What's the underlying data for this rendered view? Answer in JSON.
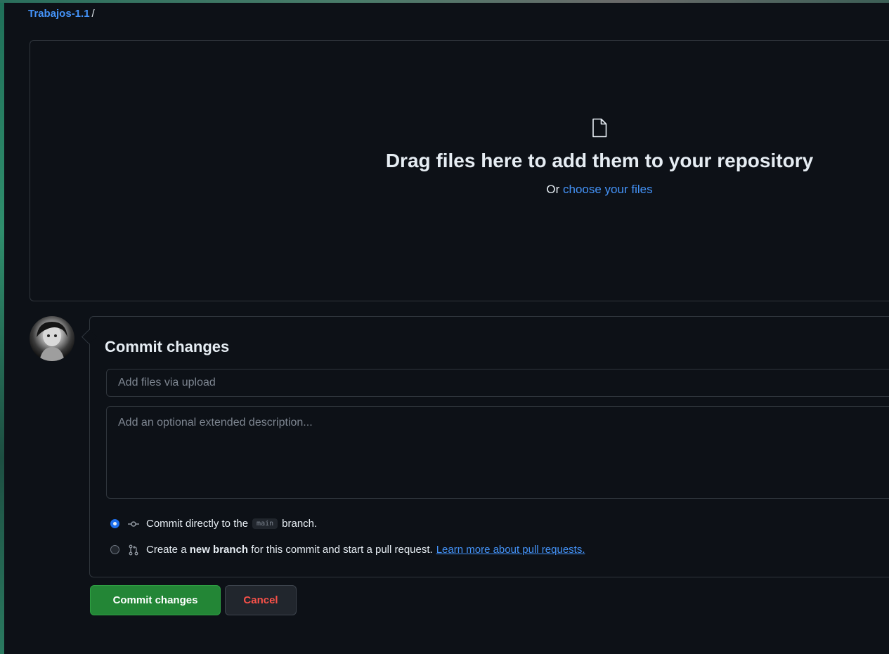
{
  "breadcrumb": {
    "repo": "Trabajos-1.1",
    "separator": "/"
  },
  "dropzone": {
    "icon": "file-icon",
    "title": "Drag files here to add them to your repository",
    "subtitle_prefix": "Or",
    "choose_link": "choose your files"
  },
  "commit": {
    "avatar": "avatar",
    "title": "Commit changes",
    "summary_placeholder": "Add files via upload",
    "description_placeholder": "Add an optional extended description...",
    "options": {
      "direct": {
        "checked": true,
        "icon": "git-commit-icon",
        "prefix": "Commit directly to the",
        "branch": "main",
        "suffix": "branch."
      },
      "new_branch": {
        "checked": false,
        "icon": "git-pull-request-icon",
        "prefix": "Create a",
        "bold": "new branch",
        "suffix": "for this commit and start a pull request.",
        "link": "Learn more about pull requests."
      }
    }
  },
  "buttons": {
    "commit_label": "Commit changes",
    "cancel_label": "Cancel"
  },
  "colors": {
    "background": "#0d1117",
    "border": "#30363d",
    "link": "#4493f8",
    "primary_button": "#238636",
    "cancel_text": "#f85149",
    "radio_checked": "#1f6feb"
  }
}
